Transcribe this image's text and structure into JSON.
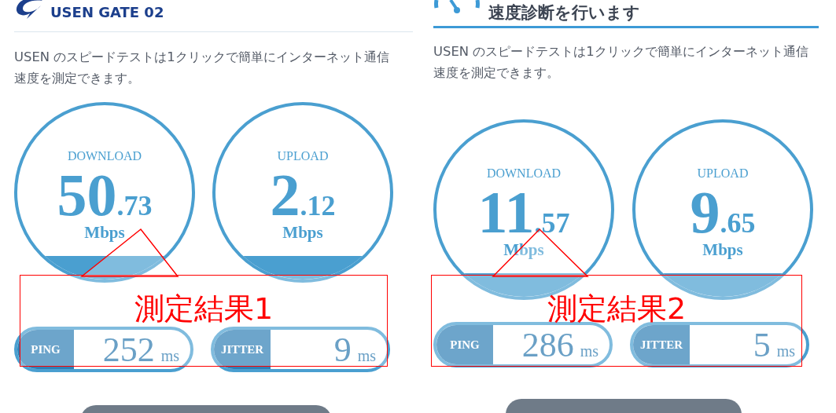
{
  "panels": [
    {
      "header": {
        "kind": "logo",
        "title": "USEN GATE 02"
      },
      "description": "USEN のスピードテストは1クリックで簡単にインターネット通信速度を測定できます。",
      "gauges": [
        {
          "label": "DOWNLOAD",
          "whole": "50",
          "fraction": ".73",
          "unit": "Mbps"
        },
        {
          "label": "UPLOAD",
          "whole": "2",
          "fraction": ".12",
          "unit": "Mbps"
        }
      ],
      "stats": [
        {
          "label": "PING",
          "value": "252",
          "unit": "ms"
        },
        {
          "label": "JITTER",
          "value": "9",
          "unit": "ms"
        }
      ],
      "callout": "測定結果1"
    },
    {
      "header": {
        "kind": "title",
        "title": "速度診断を行います"
      },
      "description": "USEN のスピードテストは1クリックで簡単にインターネット通信速度を測定できます。",
      "gauges": [
        {
          "label": "DOWNLOAD",
          "whole": "11",
          "fraction": ".57",
          "unit": "Mbps"
        },
        {
          "label": "UPLOAD",
          "whole": "9",
          "fraction": ".65",
          "unit": "Mbps"
        }
      ],
      "stats": [
        {
          "label": "PING",
          "value": "286",
          "unit": "ms"
        },
        {
          "label": "JITTER",
          "value": "5",
          "unit": "ms"
        }
      ],
      "callout": "測定結果2"
    }
  ]
}
